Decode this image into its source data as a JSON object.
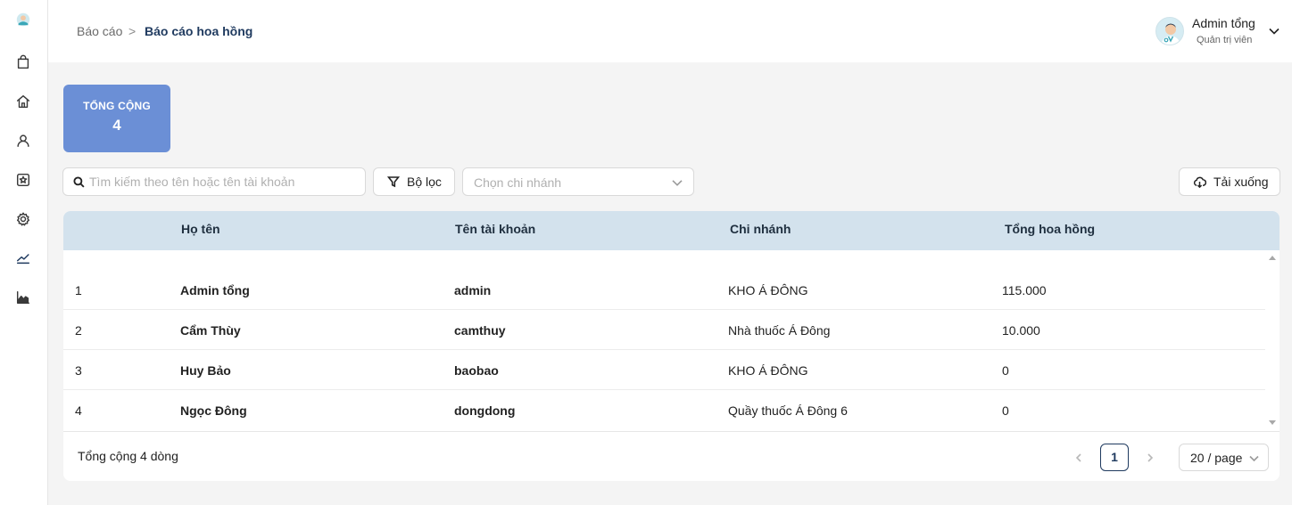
{
  "sidebar": {
    "items": [
      {
        "icon": "logo-icon"
      },
      {
        "icon": "shopping-bag-icon"
      },
      {
        "icon": "home-icon"
      },
      {
        "icon": "user-icon"
      },
      {
        "icon": "star-badge-icon"
      },
      {
        "icon": "gear-icon"
      },
      {
        "icon": "trend-line-icon"
      },
      {
        "icon": "area-chart-icon"
      }
    ]
  },
  "header": {
    "breadcrumb": {
      "parent": "Báo cáo",
      "separator": ">",
      "current": "Báo cáo hoa hồng"
    },
    "user": {
      "name": "Admin tổng",
      "role": "Quản trị viên"
    }
  },
  "summary": {
    "label": "TỔNG CỘNG",
    "value": "4",
    "color": "#6b8fd6"
  },
  "toolbar": {
    "search_placeholder": "Tìm kiếm theo tên hoặc tên tài khoản",
    "filter_label": "Bộ lọc",
    "branch_placeholder": "Chọn chi nhánh",
    "download_label": "Tải xuống"
  },
  "table": {
    "columns": [
      "Họ tên",
      "Tên tài khoản",
      "Chi nhánh",
      "Tổng hoa hồng"
    ],
    "rows": [
      {
        "index": "1",
        "name": "Admin tổng",
        "username": "admin",
        "branch": "KHO Á ĐÔNG",
        "commission": "115.000"
      },
      {
        "index": "2",
        "name": "Cẩm Thùy",
        "username": "camthuy",
        "branch": "Nhà thuốc Á Đông",
        "commission": "10.000"
      },
      {
        "index": "3",
        "name": "Huy Bảo",
        "username": "baobao",
        "branch": "KHO Á ĐÔNG",
        "commission": "0"
      },
      {
        "index": "4",
        "name": "Ngọc Đông",
        "username": "dongdong",
        "branch": "Quầy thuốc Á Đông 6",
        "commission": "0"
      }
    ],
    "header_color": "#d3e2ed"
  },
  "footer": {
    "total_rows": "Tổng cộng 4 dòng",
    "current_page": "1",
    "page_size": "20 / page"
  }
}
